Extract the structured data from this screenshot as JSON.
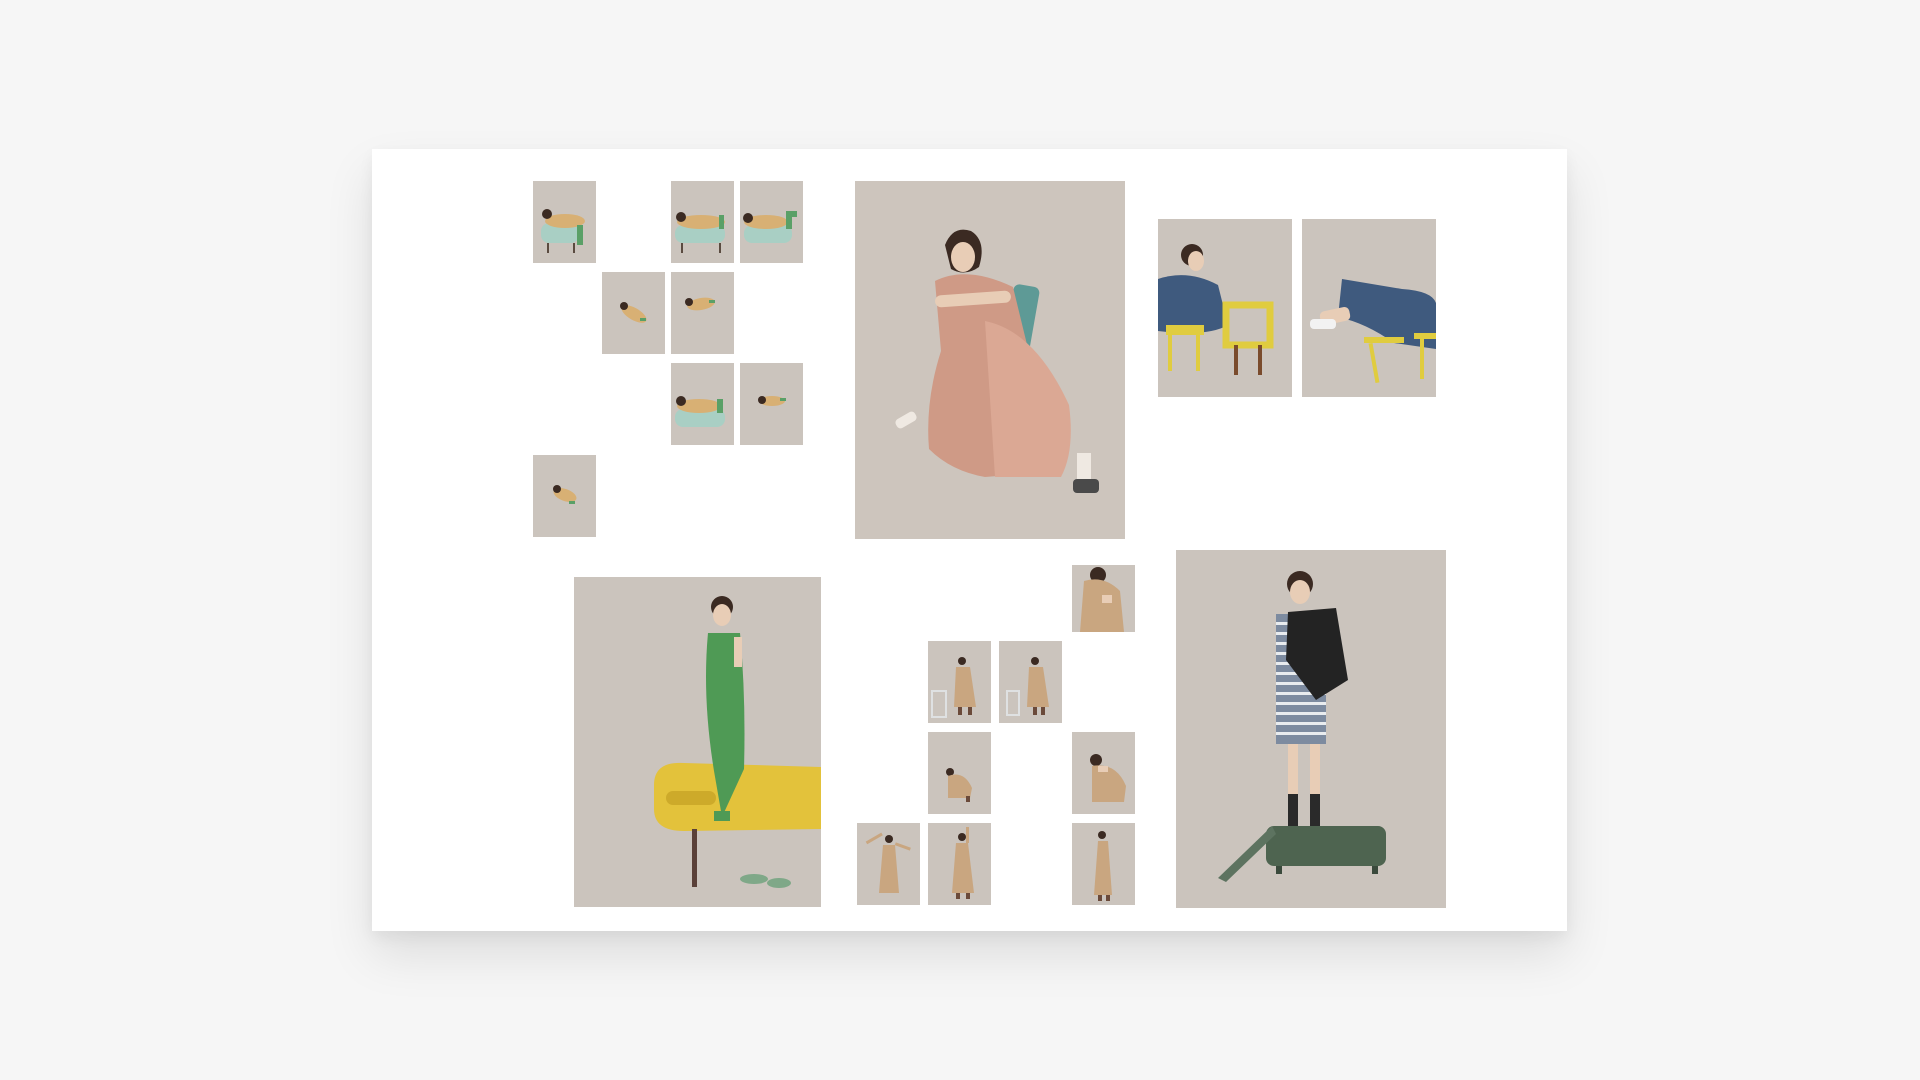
{
  "palette": {
    "page_bg": "#f6f6f6",
    "board_bg": "#ffffff",
    "backdrop": "#cbc4bd",
    "skin": "#e8cdb6",
    "hair": "#3b2a22",
    "floral_print": "#d8b074",
    "mint_sofa": "#a9cfc4",
    "blush_dress": "#cf9a86",
    "teal_chair": "#5e9a96",
    "denim": "#3f5a7e",
    "yellow_chair": "#e0cc3f",
    "green_dress": "#4f9a55",
    "yellow_sofa": "#e3c23b",
    "camel_trench": "#c9a680",
    "stripe_shirt": "#7d8ba0",
    "black_vest": "#232323",
    "green_box": "#4e6450"
  },
  "gallery": {
    "shots": [
      {
        "pose": "reclining-sofa"
      },
      {
        "pose": "reclining-sofa"
      },
      {
        "pose": "reclining-sofa"
      },
      {
        "pose": "curled-floor"
      },
      {
        "pose": "curled-floor"
      },
      {
        "pose": "reclining-sofa"
      },
      {
        "pose": "curled-floor"
      },
      {
        "pose": "curled-floor"
      },
      {
        "pose": "seated-chair"
      },
      {
        "pose": "leaning-stool"
      },
      {
        "pose": "lying-chairs"
      },
      {
        "pose": "standing-sofa"
      },
      {
        "pose": "crouched-detail"
      },
      {
        "pose": "leaning-ladder"
      },
      {
        "pose": "leaning-ladder"
      },
      {
        "pose": "crouching"
      },
      {
        "pose": "crouching"
      },
      {
        "pose": "arms-out"
      },
      {
        "pose": "standing-hand-raised"
      },
      {
        "pose": "standing"
      },
      {
        "pose": "standing-in-box"
      }
    ]
  }
}
